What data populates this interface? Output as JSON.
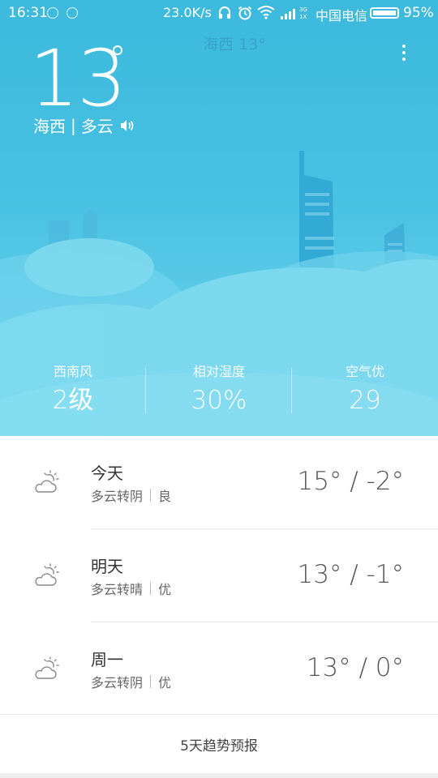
{
  "status_bar": {
    "time": "16:31",
    "net_speed": "23.0K/s",
    "carrier": "中国电信",
    "battery": "95%",
    "icons": [
      "notification-icon",
      "notification-icon",
      "headphone-icon",
      "alarm-icon",
      "wifi-icon",
      "signal-icon"
    ]
  },
  "header": {
    "faded_title": "海西 13°",
    "menu_icon": "more-vertical-icon"
  },
  "current": {
    "temperature": "13",
    "location": "海西",
    "separator": "|",
    "condition": "多云",
    "speaker_icon": "speaker-icon"
  },
  "stats": [
    {
      "label": "西南风",
      "value": "2级"
    },
    {
      "label": "相对湿度",
      "value": "30%"
    },
    {
      "label": "空气优",
      "value": "29"
    }
  ],
  "forecast": [
    {
      "day": "今天",
      "desc": "多云转阴",
      "air": "良",
      "temp": "15° / -2°",
      "icon": "partly-cloudy-icon"
    },
    {
      "day": "明天",
      "desc": "多云转晴",
      "air": "优",
      "temp": "13° / -1°",
      "icon": "partly-cloudy-icon"
    },
    {
      "day": "周一",
      "desc": "多云转阴",
      "air": "优",
      "temp": "13° / 0°",
      "icon": "partly-cloudy-icon"
    }
  ],
  "trend_link": "5天趋势预报",
  "colors": {
    "sky_top": "#3cb9dd",
    "sky_bottom": "#63cfea",
    "cloud": "#7dd9ef",
    "building": "#2fa7d2"
  }
}
